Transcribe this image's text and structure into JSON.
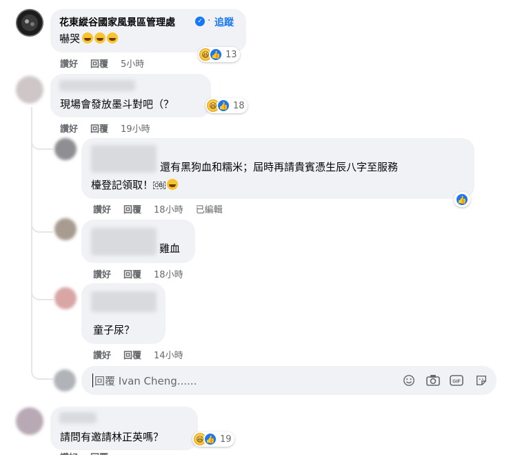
{
  "actions": {
    "like": "讚好",
    "reply": "回覆",
    "edited": "已編輯"
  },
  "comments": [
    {
      "author": "花東縱谷國家風景區管理處",
      "follow": "追蹤",
      "text": "嚇哭",
      "time": "5小時",
      "reactions": "13"
    },
    {
      "text": "現場會發放墨斗對吧（？",
      "time": "19小時",
      "reactions": "18"
    },
    {
      "text_line1": "還有黑狗血和糯米；屆時再請貴賓憑生辰八字至服務",
      "text_line2": "檯登記領取！",
      "obj": "OBJ",
      "time": "18小時"
    },
    {
      "text": "雞血",
      "time": "18小時"
    },
    {
      "text": "童子尿？",
      "time": "14小時"
    },
    {
      "text": "請問有邀請林正英嗎？",
      "reactions": "19"
    }
  ],
  "reply_box": {
    "placeholder": "回覆 Ivan Cheng......"
  },
  "icons": {
    "verified": "verified-badge-icon",
    "emoji": "emoji-icon",
    "camera": "camera-icon",
    "gif": "gif-icon",
    "sticker": "sticker-icon"
  },
  "colors": {
    "bubble": "#f0f2f5",
    "link": "#1877f2",
    "meta": "#65676b"
  }
}
